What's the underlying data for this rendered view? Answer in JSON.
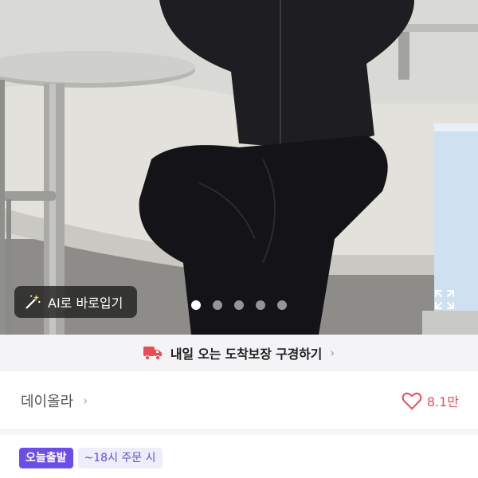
{
  "gallery": {
    "ai_fit_label": "AI로 바로입기",
    "dot_count": 5,
    "active_dot": 0
  },
  "delivery": {
    "label": "내일 오는 도착보장 구경하기",
    "chevron": "›"
  },
  "shop": {
    "name": "데이올라",
    "chevron": "›",
    "likes": "8.1만"
  },
  "badges": {
    "primary": "오늘출발",
    "secondary": "~18시 주문 시"
  },
  "colors": {
    "accent_purple": "#6b4ee8",
    "like_red": "#e0525d",
    "truck_red": "#ec4b56"
  },
  "icons": [
    "magic-wand-icon",
    "expand-icon",
    "truck-icon",
    "heart-icon",
    "chevron-right-icon"
  ]
}
